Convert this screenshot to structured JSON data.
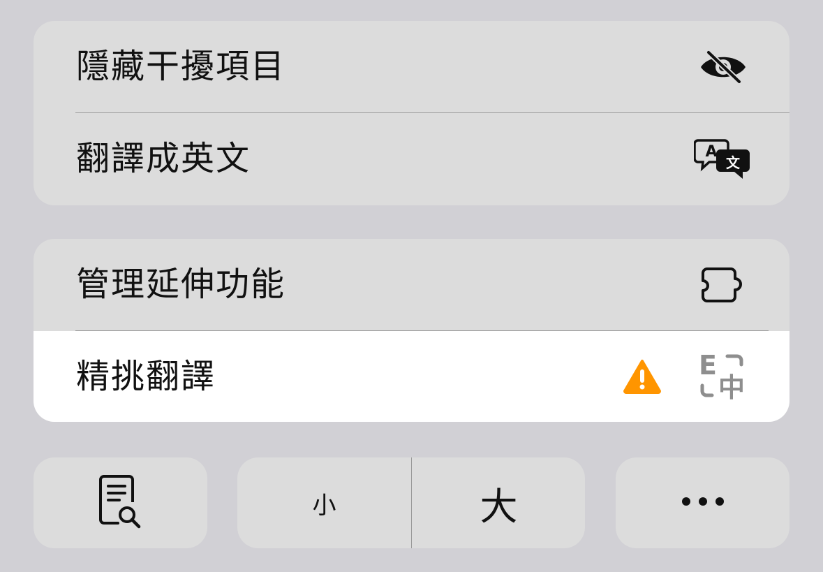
{
  "menu_group_1": {
    "items": [
      {
        "label": "隱藏干擾項目",
        "icon": "eye-slash-icon"
      },
      {
        "label": "翻譯成英文",
        "icon": "translate-icon"
      }
    ]
  },
  "menu_group_2": {
    "items": [
      {
        "label": "管理延伸功能",
        "icon": "puzzle-extension-icon"
      },
      {
        "label": "精挑翻譯",
        "icon": "english-chinese-translate-icon",
        "warning_icon": "warning-triangle-icon"
      }
    ]
  },
  "bottom_bar": {
    "reader_icon": "reader-document-search-icon",
    "font_small_label": "小",
    "font_large_label": "大",
    "more_icon": "ellipsis-icon"
  },
  "colors": {
    "background": "#d1d0d5",
    "card": "#dcdcdc",
    "highlight": "#ffffff",
    "warning": "#ff9500",
    "disabled_icon": "#8e8e8e"
  }
}
